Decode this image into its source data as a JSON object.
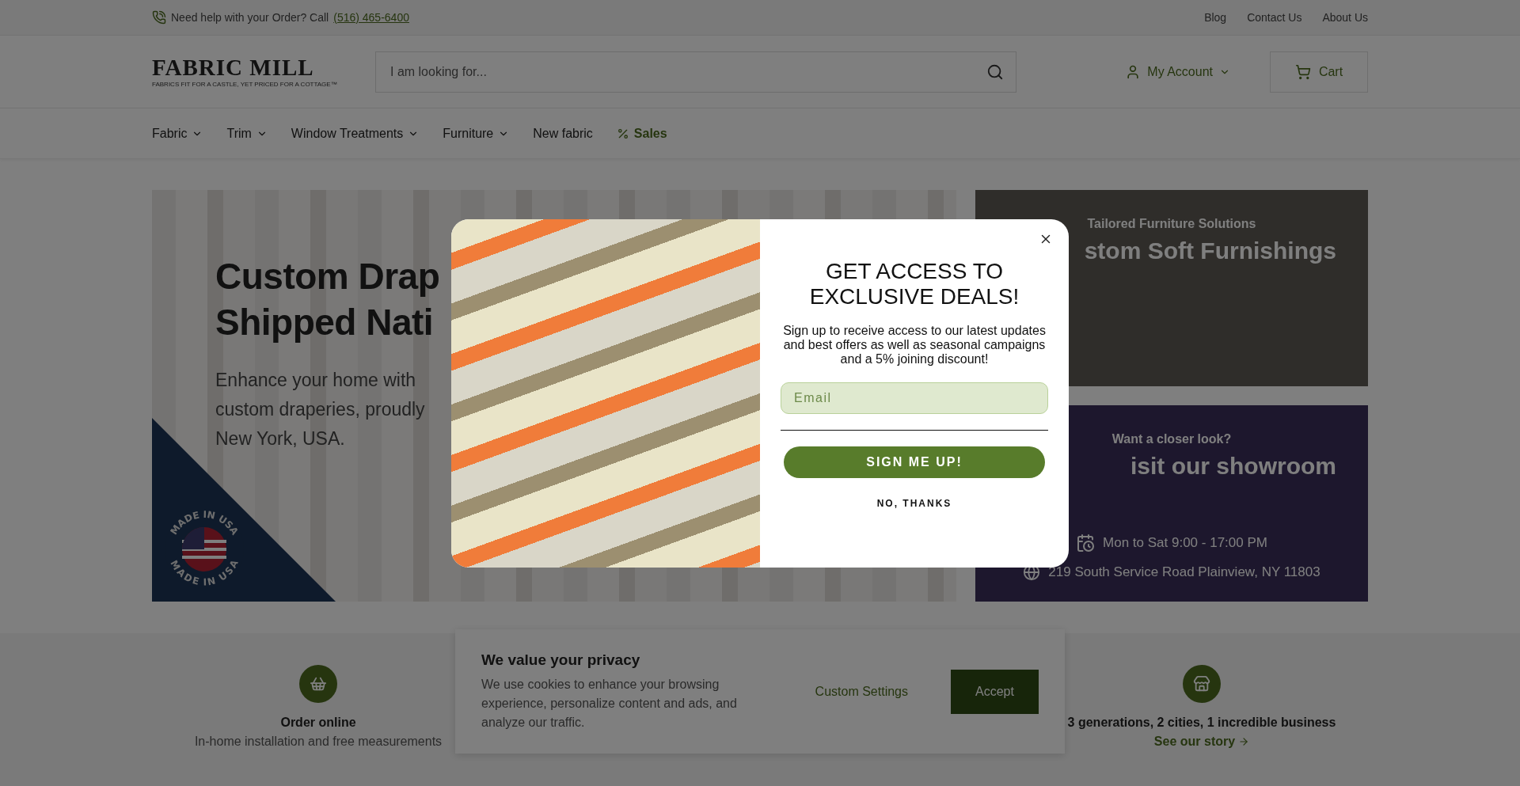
{
  "top_bar": {
    "help_text": "Need help with your Order? Call",
    "phone": "(516) 465-6400",
    "links": [
      "Blog",
      "Contact Us",
      "About Us"
    ]
  },
  "header": {
    "logo": {
      "name": "FABRIC MILL",
      "tagline": "FABRICS FIT FOR A CASTLE, YET PRICED FOR A COTTAGE™"
    },
    "search": {
      "placeholder": "I am looking for..."
    },
    "account": "My Account",
    "cart": "Cart"
  },
  "nav": [
    {
      "label": "Fabric",
      "kind": "dropdown"
    },
    {
      "label": "Trim",
      "kind": "dropdown"
    },
    {
      "label": "Window Treatments",
      "kind": "dropdown"
    },
    {
      "label": "Furniture",
      "kind": "dropdown"
    },
    {
      "label": "New fabric",
      "kind": "link"
    },
    {
      "label": "Sales",
      "kind": "sale"
    }
  ],
  "hero": {
    "heading": [
      "Custom Drap",
      "Shipped Nati"
    ],
    "text": [
      "Enhance your home with",
      "custom draperies, proudly",
      "New York, USA."
    ],
    "badge": [
      "MADE IN USA",
      "MADE IN USA"
    ]
  },
  "side_cards": [
    {
      "kicker": "Tailored Furniture Solutions",
      "title": "stom Soft Furnishings"
    },
    {
      "kicker": "Want a closer look?",
      "title": "isit our showroom",
      "hours": "Mon to Sat 9:00 - 17:00 PM",
      "address": "219 South Service Road Plainview, NY 11803"
    }
  ],
  "features": [
    {
      "title": "Order online",
      "text": "In-home installation and free measurements",
      "kind": "text"
    },
    {
      "title": "3 generations, 2 cities, 1 incredible business",
      "text": "See our story",
      "kind": "link"
    }
  ],
  "cookie_banner": {
    "title": "We value your privacy",
    "text": "We use cookies to enhance your browsing experience, personalize content and ads, and analyze our traffic.",
    "settings": "Custom Settings",
    "accept": "Accept"
  },
  "popup": {
    "title": [
      "GET ACCESS TO",
      "EXCLUSIVE DEALS!"
    ],
    "text": "Sign up to receive access to our latest updates and best offers as well as seasonal campaigns and a 5% joining discount!",
    "email": {
      "placeholder": "Email"
    },
    "submit": "SIGN ME UP!",
    "decline": "NO, THANKS"
  }
}
